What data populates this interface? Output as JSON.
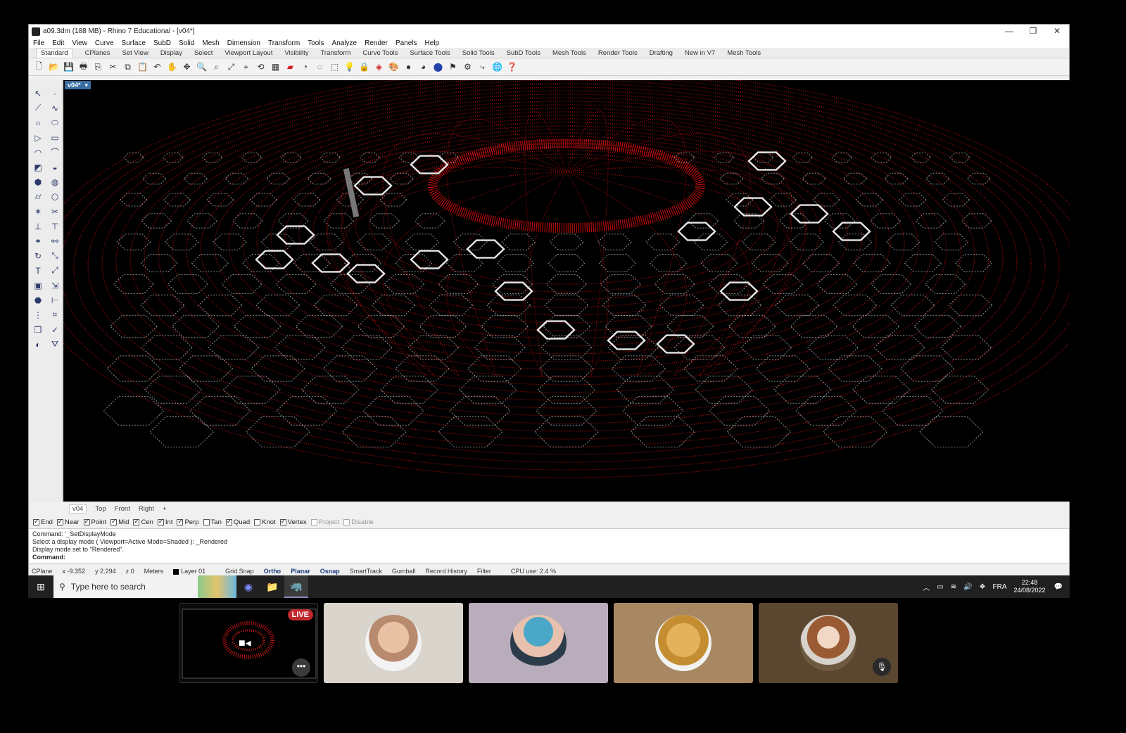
{
  "window": {
    "title": "a09.3dm (188 MB) - Rhino 7 Educational - [v04*]",
    "controls": [
      "—",
      "❐",
      "✕"
    ]
  },
  "menubar": [
    "File",
    "Edit",
    "View",
    "Curve",
    "Surface",
    "SubD",
    "Solid",
    "Mesh",
    "Dimension",
    "Transform",
    "Tools",
    "Analyze",
    "Render",
    "Panels",
    "Help"
  ],
  "tabbar": [
    "Standard",
    "CPlanes",
    "Set View",
    "Display",
    "Select",
    "Viewport Layout",
    "Visibility",
    "Transform",
    "Curve Tools",
    "Surface Tools",
    "Solid Tools",
    "SubD Tools",
    "Mesh Tools",
    "Render Tools",
    "Drafting",
    "New in V7",
    "Mesh Tools"
  ],
  "viewport": {
    "label": "v04*",
    "label_arrow": "▾",
    "tabs": [
      "v04",
      "Top",
      "Front",
      "Right",
      "+"
    ]
  },
  "osnap": [
    {
      "label": "End",
      "checked": true
    },
    {
      "label": "Near",
      "checked": true
    },
    {
      "label": "Point",
      "checked": true
    },
    {
      "label": "Mid",
      "checked": true
    },
    {
      "label": "Cen",
      "checked": true
    },
    {
      "label": "Int",
      "checked": true
    },
    {
      "label": "Perp",
      "checked": true
    },
    {
      "label": "Tan",
      "checked": false
    },
    {
      "label": "Quad",
      "checked": true
    },
    {
      "label": "Knot",
      "checked": false
    },
    {
      "label": "Vertex",
      "checked": true
    },
    {
      "label": "Project",
      "checked": false,
      "dim": true
    },
    {
      "label": "Disable",
      "checked": false,
      "dim": true
    }
  ],
  "command": {
    "history": [
      "Command: '_SetDisplayMode",
      "Select a display mode ( Viewport=Active  Mode=Shaded ): _Rendered",
      "Display mode set to \"Rendered\"."
    ],
    "prompt": "Command:"
  },
  "status": {
    "cplane": "CPlane",
    "x": "x -9.352",
    "y": "y 2.294",
    "z": "z 0",
    "units": "Meters",
    "layer": "Layer 01",
    "toggles": [
      {
        "label": "Grid Snap",
        "bold": false
      },
      {
        "label": "Ortho",
        "bold": true
      },
      {
        "label": "Planar",
        "bold": true
      },
      {
        "label": "Osnap",
        "bold": true
      },
      {
        "label": "SmartTrack",
        "bold": false
      },
      {
        "label": "Gumball",
        "bold": false
      },
      {
        "label": "Record History",
        "bold": false
      },
      {
        "label": "Filter",
        "bold": false
      }
    ],
    "cpu": "CPU use: 2.4 %"
  },
  "taskbar": {
    "search_placeholder": "Type here to search",
    "lang": "FRA",
    "time": "22:48",
    "date": "24/08/2022"
  },
  "call": {
    "live_badge": "LIVE",
    "more": "•••"
  },
  "colors": {
    "accent": "#3a6ea5",
    "wire_red": "#e01010",
    "wire_white": "#ffffff"
  }
}
